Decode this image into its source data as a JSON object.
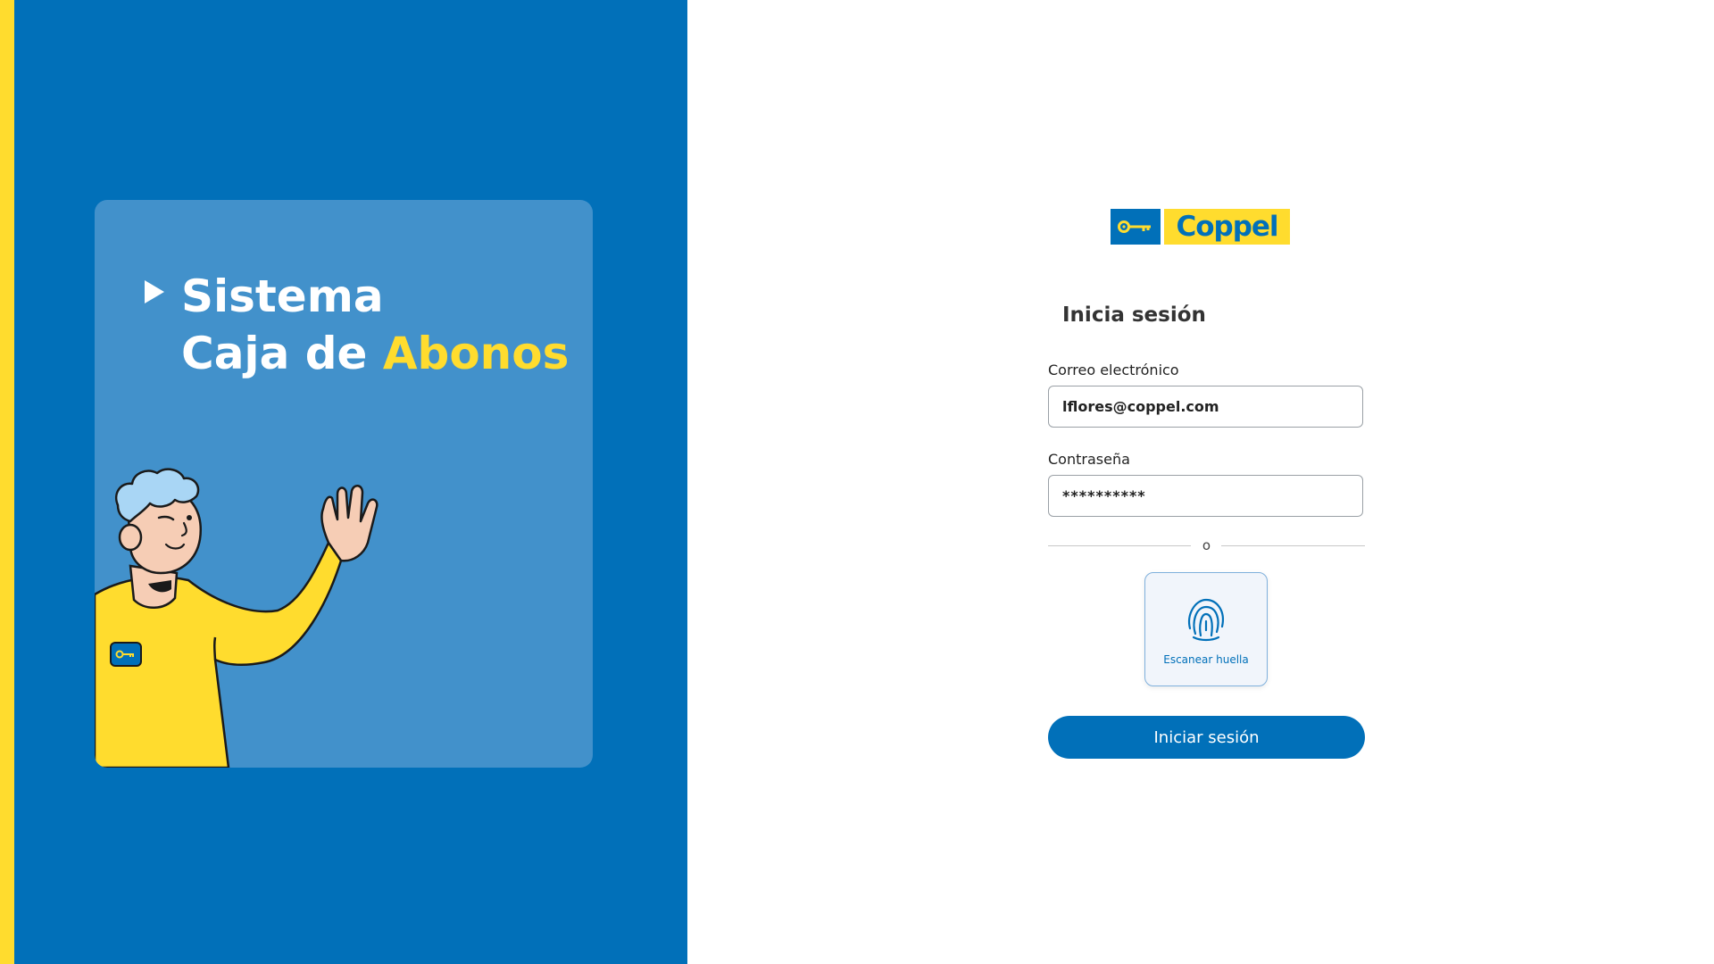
{
  "hero": {
    "title_line1": "Sistema",
    "title_line2_prefix": "Caja de ",
    "title_line2_accent": "Abonos"
  },
  "brand": {
    "logo_text": "Coppel",
    "primary_color": "#0170b9",
    "accent_color": "#ffdc2e",
    "panel_light_color": "#4291cb"
  },
  "login": {
    "title": "Inicia sesión",
    "email_label": "Correo electrónico",
    "email_value": "lflores@coppel.com",
    "password_label": "Contraseña",
    "password_value": "**********",
    "divider_text": "o",
    "scan_label": "Escanear huella",
    "scan_icon": "fingerprint-icon",
    "submit_label": "Iniciar sesión"
  }
}
